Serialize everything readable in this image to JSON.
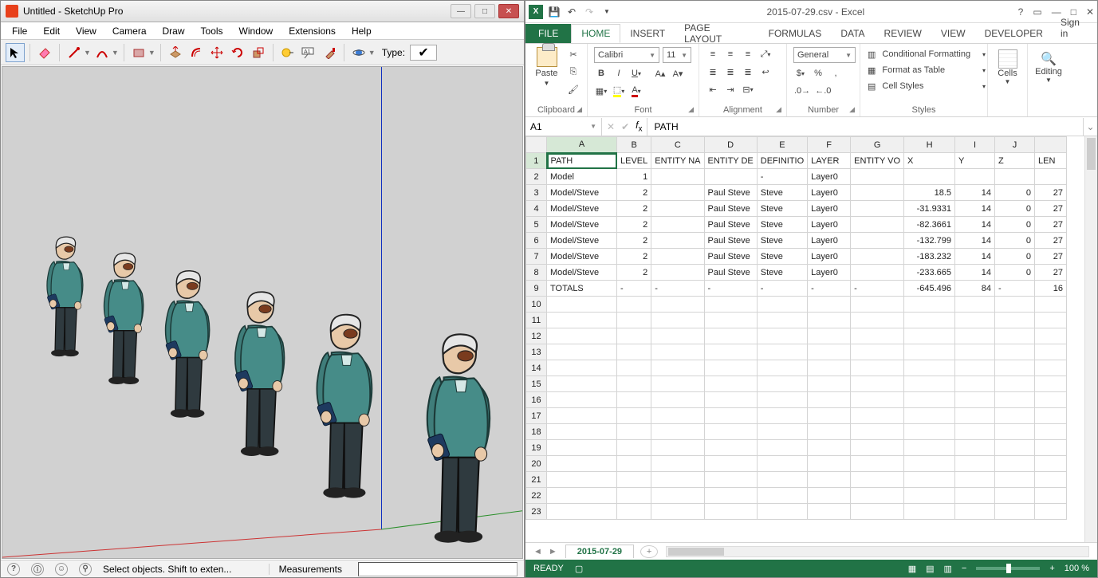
{
  "sketchup": {
    "title": "Untitled - SketchUp Pro",
    "menu": [
      "File",
      "Edit",
      "View",
      "Camera",
      "Draw",
      "Tools",
      "Window",
      "Extensions",
      "Help"
    ],
    "type_label": "Type:",
    "status_hint": "Select objects. Shift to exten...",
    "measurements_label": "Measurements"
  },
  "excel": {
    "title": "2015-07-29.csv - Excel",
    "signin": "Sign in",
    "tabs": {
      "file": "FILE",
      "home": "HOME",
      "insert": "INSERT",
      "page": "PAGE LAYOUT",
      "formulas": "FORMULAS",
      "data": "DATA",
      "review": "REVIEW",
      "view": "VIEW",
      "developer": "DEVELOPER"
    },
    "ribbon": {
      "paste": "Paste",
      "clipboard": "Clipboard",
      "font_name": "Calibri",
      "font_size": "11",
      "font": "Font",
      "alignment": "Alignment",
      "numberfmt": "General",
      "number": "Number",
      "condfmt": "Conditional Formatting",
      "fmttable": "Format as Table",
      "cellstyles": "Cell Styles",
      "styles": "Styles",
      "cells": "Cells",
      "editing": "Editing"
    },
    "namebox": "A1",
    "formula": "PATH",
    "columns": [
      "A",
      "B",
      "C",
      "D",
      "E",
      "F",
      "G",
      "H",
      "I",
      "J"
    ],
    "headers": [
      "PATH",
      "LEVEL",
      "ENTITY NA",
      "ENTITY DE",
      "DEFINITIO",
      "LAYER",
      "ENTITY VO",
      "X",
      "Y",
      "Z",
      "LEN"
    ],
    "rows": [
      [
        "Model",
        "1",
        "",
        "",
        "-",
        "Layer0",
        "",
        "",
        "",
        "",
        ""
      ],
      [
        "Model/Steve",
        "2",
        "",
        "Paul Steve",
        "Steve",
        "Layer0",
        "",
        "18.5",
        "14",
        "0",
        "27"
      ],
      [
        "Model/Steve",
        "2",
        "",
        "Paul Steve",
        "Steve",
        "Layer0",
        "",
        "-31.9331",
        "14",
        "0",
        "27"
      ],
      [
        "Model/Steve",
        "2",
        "",
        "Paul Steve",
        "Steve",
        "Layer0",
        "",
        "-82.3661",
        "14",
        "0",
        "27"
      ],
      [
        "Model/Steve",
        "2",
        "",
        "Paul Steve",
        "Steve",
        "Layer0",
        "",
        "-132.799",
        "14",
        "0",
        "27"
      ],
      [
        "Model/Steve",
        "2",
        "",
        "Paul Steve",
        "Steve",
        "Layer0",
        "",
        "-183.232",
        "14",
        "0",
        "27"
      ],
      [
        "Model/Steve",
        "2",
        "",
        "Paul Steve",
        "Steve",
        "Layer0",
        "",
        "-233.665",
        "14",
        "0",
        "27"
      ],
      [
        "TOTALS",
        "-",
        "-",
        "-",
        "-",
        "-",
        "-",
        "-645.496",
        "84",
        "-",
        "16"
      ]
    ],
    "sheet_tab": "2015-07-29",
    "status": "READY",
    "zoom": "100 %"
  }
}
